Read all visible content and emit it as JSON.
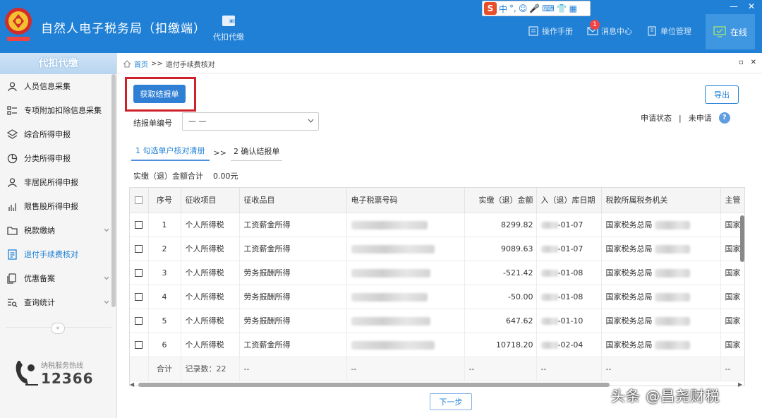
{
  "app": {
    "title": "自然人电子税务局（扣缴端）",
    "top_func_label": "代扣代缴",
    "manual_label": "操作手册",
    "message_label": "消息中心",
    "message_count": "1",
    "unit_label": "单位管理",
    "online_label": "在线",
    "accent_color": "#1f80d6"
  },
  "ime": {
    "mode": "中",
    "punct": "°,"
  },
  "sidebar": {
    "header": "代扣代缴",
    "items": [
      {
        "label": "人员信息采集",
        "icon": "person-icon"
      },
      {
        "label": "专项附加扣除信息采集",
        "icon": "list-icon"
      },
      {
        "label": "综合所得申报",
        "icon": "layers-icon"
      },
      {
        "label": "分类所得申报",
        "icon": "pie-icon"
      },
      {
        "label": "非居民所得申报",
        "icon": "person-icon"
      },
      {
        "label": "限售股所得申报",
        "icon": "bar-chart-icon"
      },
      {
        "label": "税款缴纳",
        "icon": "folder-icon"
      },
      {
        "label": "退付手续费核对",
        "icon": "document-icon"
      },
      {
        "label": "优惠备案",
        "icon": "copy-icon"
      },
      {
        "label": "查询统计",
        "icon": "search-list-icon"
      }
    ],
    "hotline_label": "纳税服务热线",
    "hotline_number": "12366"
  },
  "breadcrumb": {
    "home": "首页",
    "sep": ">>",
    "current": "退付手续费核对"
  },
  "toolbar": {
    "get_report_label": "获取结报单",
    "export_label": "导出"
  },
  "form": {
    "report_no_label": "结报单编号",
    "report_no_value": "— —",
    "status_label": "申请状态",
    "status_sep": "|",
    "status_value": "未申请",
    "help": "?"
  },
  "steps": {
    "step1": "1 勾选单户核对清册",
    "arrow": ">>",
    "step2": "2 确认结报单"
  },
  "summary": {
    "label": "实缴（退）金额合计",
    "value": "0.00元"
  },
  "table": {
    "headers": [
      "序号",
      "征收项目",
      "征收品目",
      "电子税票号码",
      "实缴（退）金额",
      "入（退）库日期",
      "税款所属税务机关",
      "主管"
    ],
    "rows": [
      {
        "no": "1",
        "item": "个人所得税",
        "sub": "工资薪金所得",
        "amount": "8299.82",
        "date": "-01-07",
        "office": "国家税务总局",
        "more": "国家"
      },
      {
        "no": "2",
        "item": "个人所得税",
        "sub": "工资薪金所得",
        "amount": "9089.63",
        "date": "-01-07",
        "office": "国家税务总局",
        "more": "国家"
      },
      {
        "no": "3",
        "item": "个人所得税",
        "sub": "劳务报酬所得",
        "amount": "-521.42",
        "date": "-01-08",
        "office": "国家税务总局",
        "more": "国家"
      },
      {
        "no": "4",
        "item": "个人所得税",
        "sub": "劳务报酬所得",
        "amount": "-50.00",
        "date": "-01-08",
        "office": "国家税务总局",
        "more": "国家"
      },
      {
        "no": "5",
        "item": "个人所得税",
        "sub": "劳务报酬所得",
        "amount": "647.62",
        "date": "-01-10",
        "office": "国家税务总局",
        "more": "国家"
      },
      {
        "no": "6",
        "item": "个人所得税",
        "sub": "工资薪金所得",
        "amount": "10718.20",
        "date": "-02-04",
        "office": "国家税务总局",
        "more": "国家"
      }
    ],
    "footer": {
      "label": "合计",
      "count": "记录数：22",
      "dash": "--"
    }
  },
  "next_label": "下一步",
  "watermark": "头条 @昌尧财税"
}
